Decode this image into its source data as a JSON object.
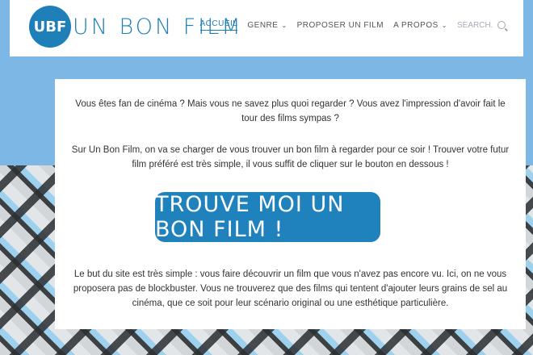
{
  "logo": {
    "badge": "UBF",
    "text": "UN BON FILM"
  },
  "nav": {
    "items": [
      {
        "label": "ACCUEIL",
        "active": true
      },
      {
        "label": "GENRE",
        "dropdown": true
      },
      {
        "label": "PROPOSER UN FILM"
      },
      {
        "label": "A PROPOS",
        "dropdown": true
      }
    ],
    "search_placeholder": "SEARCH..."
  },
  "main": {
    "intro": "Vous êtes fan de cinéma ? Mais vous ne savez plus quoi regarder ? Vous avez l'impression d'avoir fait le tour des films sympas ?",
    "description": "Sur Un Bon Film, on va se charger de vous trouver un bon film à regarder pour ce soir ! Trouver votre futur film préféré est très simple, il vous suffit de cliquer sur le bouton en dessous !",
    "cta_label": "TROUVE MOI UN BON FILM !",
    "about": "Le but du site est très simple : vous faire découvrir un film que vous n'avez pas encore vu. Ici, on ne vous proposera pas de blockbuster. Vous ne trouverez que des films qui tentent d'ajouter leurs grains de sel au cinéma, que ce soit pour leur scénario original ou une esthétique particulière."
  },
  "colors": {
    "brand": "#1f82bd",
    "background": "#7cb7e6"
  }
}
